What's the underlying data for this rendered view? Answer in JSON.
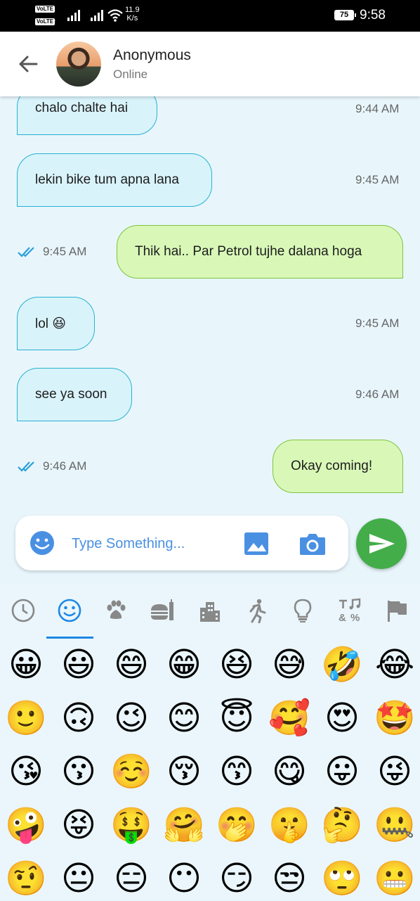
{
  "status_bar": {
    "volte1": "VoLTE",
    "volte2": "VoLTE",
    "sim1": "1",
    "sim2": "2",
    "net_speed_value": "11.9",
    "net_speed_unit": "K/s",
    "battery": "75",
    "time": "9:58"
  },
  "header": {
    "contact_name": "Anonymous",
    "contact_status": "Online"
  },
  "messages": [
    {
      "direction": "incoming",
      "text": "chalo chalte hai",
      "time": "9:44 AM"
    },
    {
      "direction": "incoming",
      "text": "lekin bike tum apna lana",
      "time": "9:45 AM"
    },
    {
      "direction": "outgoing",
      "text": "Thik hai.. Par Petrol tujhe dalana hoga",
      "time": "9:45 AM",
      "read": true
    },
    {
      "direction": "incoming",
      "text": "lol 😆",
      "time": "9:45 AM"
    },
    {
      "direction": "incoming",
      "text": "see ya soon",
      "time": "9:46 AM"
    },
    {
      "direction": "outgoing",
      "text": "Okay coming!",
      "time": "9:46 AM",
      "read": true
    }
  ],
  "composer": {
    "placeholder": "Type Something...",
    "value": ""
  },
  "emoji_keyboard": {
    "categories": [
      "recent-icon",
      "smileys-icon",
      "animals-icon",
      "food-icon",
      "places-icon",
      "activity-icon",
      "objects-icon",
      "symbols-icon",
      "flags-icon"
    ],
    "selected_category": "smileys-icon",
    "emojis": [
      [
        "😀",
        "😃",
        "😄",
        "😁",
        "😆",
        "😅",
        "🤣",
        "😂"
      ],
      [
        "🙂",
        "🙃",
        "😉",
        "😊",
        "😇",
        "🥰",
        "😍",
        "🤩"
      ],
      [
        "😘",
        "😗",
        "☺️",
        "😚",
        "😙",
        "😋",
        "😛",
        "😜"
      ],
      [
        "🤪",
        "😝",
        "🤑",
        "🤗",
        "🤭",
        "🤫",
        "🤔",
        "🤐"
      ],
      [
        "🤨",
        "😐",
        "😑",
        "😶",
        "😏",
        "😒",
        "🙄",
        "😬"
      ]
    ]
  },
  "colors": {
    "chat_background": "#e8f6fc",
    "incoming_bubble": "#d9f3fb",
    "incoming_border": "#27b1cf",
    "outgoing_bubble": "#d9f8b8",
    "outgoing_border": "#7fc33c",
    "send_button": "#43ad49",
    "accent": "#1e88e5"
  }
}
